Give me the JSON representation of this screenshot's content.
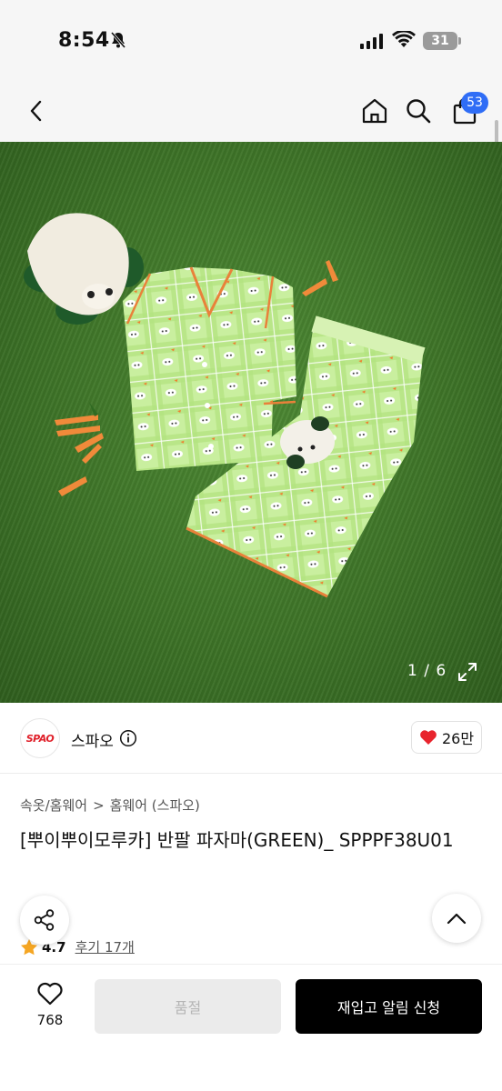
{
  "status_bar": {
    "time": "8:54",
    "battery": "31"
  },
  "header": {
    "cart_count": "53"
  },
  "gallery": {
    "counter": "1 / 6"
  },
  "brand": {
    "logo_text": "SPAO",
    "name": "스파오",
    "likes": "26만"
  },
  "breadcrumb": {
    "category": "속옷/홈웨어",
    "separator": ">",
    "subcategory": "홈웨어 (스파오)"
  },
  "product": {
    "title": "[뿌이뿌이모루카] 반팔 파자마(GREEN)_ SPPPF38U01"
  },
  "rating": {
    "score": "4.7",
    "review_label": "후기 17개"
  },
  "bottom_bar": {
    "wish_count": "768",
    "soldout_label": "품절",
    "restock_label": "재입고 알림 신청"
  },
  "colors": {
    "accent_blue": "#2f6df6",
    "heart_red": "#e8242d",
    "star_yellow": "#f5a623",
    "grass_green": "#3e7428"
  },
  "icons": [
    "bell-off-icon",
    "signal-icon",
    "wifi-icon",
    "battery-icon",
    "back-arrow-icon",
    "home-icon",
    "search-icon",
    "shopping-bag-icon",
    "expand-icon",
    "info-icon",
    "heart-icon",
    "chevron-right-icon",
    "share-icon",
    "star-icon",
    "chevron-up-icon"
  ]
}
